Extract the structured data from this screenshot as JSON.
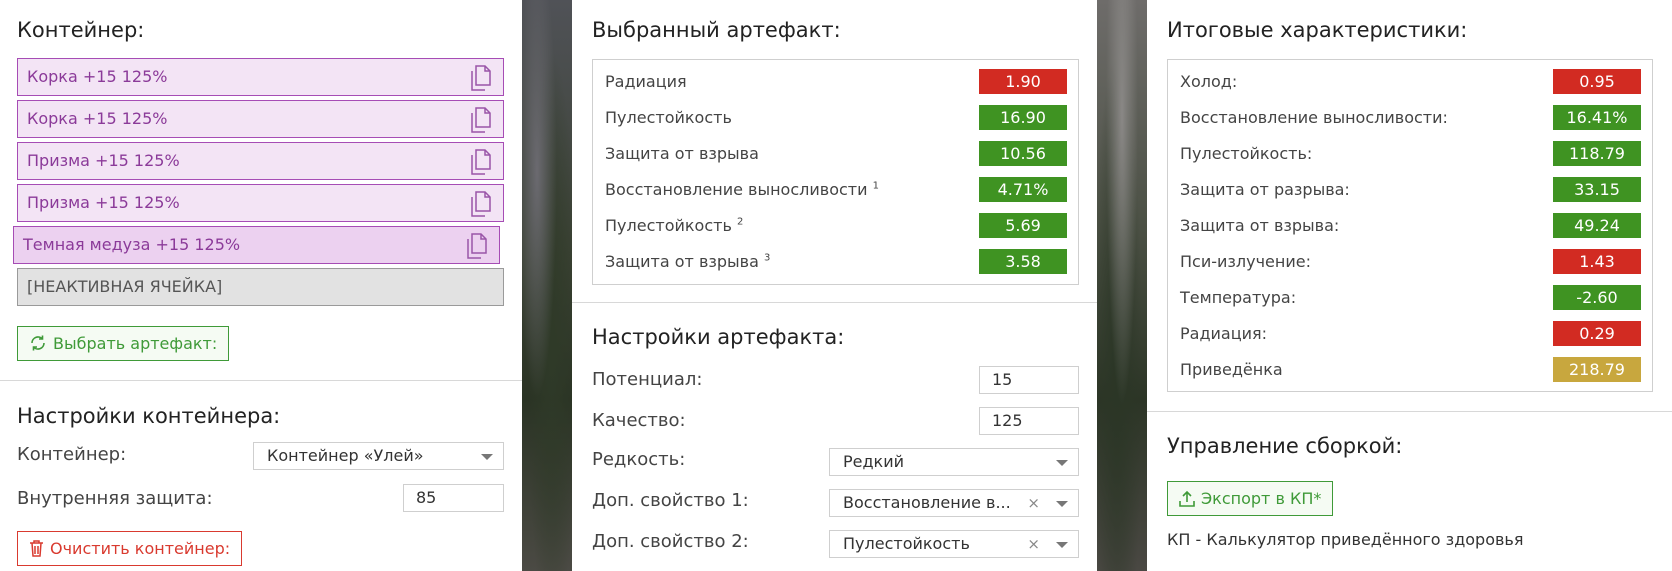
{
  "container": {
    "title": "Контейнер:",
    "slots": [
      {
        "label": "Корка +15 125%"
      },
      {
        "label": "Корка +15 125%"
      },
      {
        "label": "Призма +15 125%"
      },
      {
        "label": "Призма +15 125%"
      },
      {
        "label": "Темная медуза +15 125%"
      }
    ],
    "inactive_slot": "[НЕАКТИВНАЯ ЯЧЕЙКА]",
    "select_button": "Выбрать артефакт:"
  },
  "container_settings": {
    "title": "Настройки контейнера:",
    "container_label": "Контейнер:",
    "container_value": "Контейнер «Улей»",
    "inner_protection_label": "Внутренняя защита:",
    "inner_protection_value": "85",
    "clear_button": "Очистить контейнер:"
  },
  "selected_artifact": {
    "title": "Выбранный артефакт:",
    "stats": [
      {
        "name": "Радиация",
        "sup": "",
        "value": "1.90",
        "status": "bad"
      },
      {
        "name": "Пулестойкость",
        "sup": "",
        "value": "16.90",
        "status": "good"
      },
      {
        "name": "Защита от взрыва",
        "sup": "",
        "value": "10.56",
        "status": "good"
      },
      {
        "name": "Восстановление выносливости",
        "sup": "1",
        "value": "4.71%",
        "status": "good"
      },
      {
        "name": "Пулестойкость",
        "sup": "2",
        "value": "5.69",
        "status": "good"
      },
      {
        "name": "Защита от взрыва",
        "sup": "3",
        "value": "3.58",
        "status": "good"
      }
    ]
  },
  "artifact_settings": {
    "title": "Настройки артефакта:",
    "potential_label": "Потенциал:",
    "potential_value": "15",
    "quality_label": "Качество:",
    "quality_value": "125",
    "rarity_label": "Редкость:",
    "rarity_value": "Редкий",
    "extra1_label": "Доп. свойство 1:",
    "extra1_value": "Восстановление в...",
    "extra2_label": "Доп. свойство 2:",
    "extra2_value": "Пулестойкость"
  },
  "totals": {
    "title": "Итоговые характеристики:",
    "stats": [
      {
        "name": "Холод:",
        "value": "0.95",
        "status": "bad"
      },
      {
        "name": "Восстановление выносливости:",
        "value": "16.41%",
        "status": "good"
      },
      {
        "name": "Пулестойкость:",
        "value": "118.79",
        "status": "good"
      },
      {
        "name": "Защита от разрыва:",
        "value": "33.15",
        "status": "good"
      },
      {
        "name": "Защита от взрыва:",
        "value": "49.24",
        "status": "good"
      },
      {
        "name": "Пси-излучение:",
        "value": "1.43",
        "status": "bad"
      },
      {
        "name": "Температура:",
        "value": "-2.60",
        "status": "good"
      },
      {
        "name": "Радиация:",
        "value": "0.29",
        "status": "bad"
      },
      {
        "name": "Приведёнка",
        "value": "218.79",
        "status": "gold"
      }
    ]
  },
  "build_management": {
    "title": "Управление сборкой:",
    "export_button": "Экспорт в КП*",
    "footnote": "КП - Калькулятор приведённого здоровья"
  },
  "colors": {
    "good": "#3f9322",
    "bad": "#d22b22",
    "gold": "#c8a73e",
    "slot_border": "#a64cb5",
    "accent_green": "#3f9a38",
    "accent_red": "#d93a2f"
  }
}
